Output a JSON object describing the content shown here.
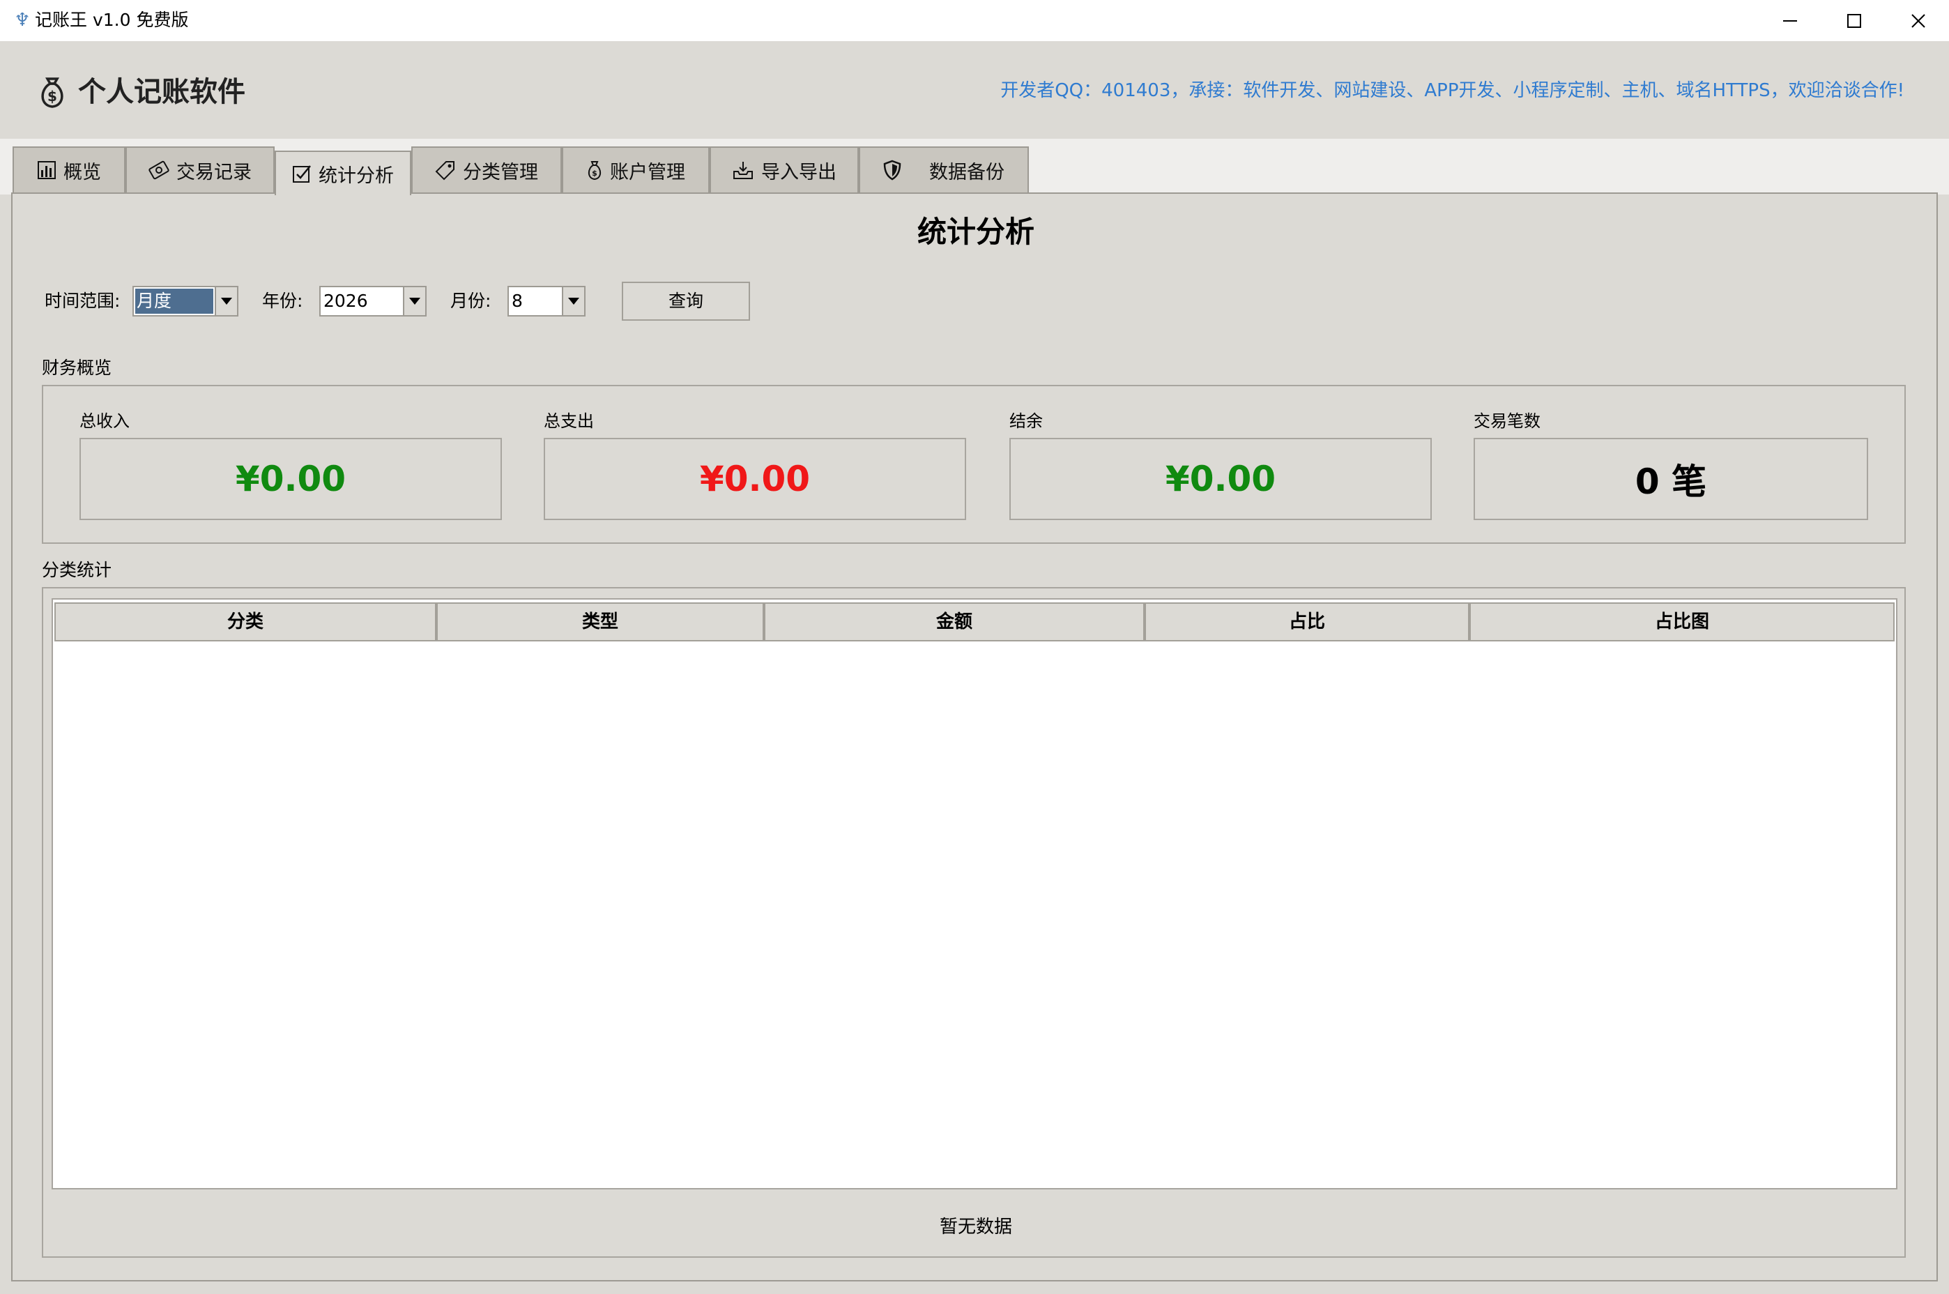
{
  "window": {
    "title": "记账王 v1.0 免费版",
    "controls": {
      "minimize": "minimize-icon",
      "maximize": "maximize-icon",
      "close": "close-icon"
    }
  },
  "header": {
    "app_title": "个人记账软件",
    "developer_note": "开发者QQ：401403，承接：软件开发、网站建设、APP开发、小程序定制、主机、域名HTTPS，欢迎洽谈合作!"
  },
  "tabs": [
    {
      "label": "概览",
      "icon": "bar-chart-icon"
    },
    {
      "label": "交易记录",
      "icon": "money-icon"
    },
    {
      "label": "统计分析",
      "icon": "checkbox-icon",
      "active": true
    },
    {
      "label": "分类管理",
      "icon": "tag-icon"
    },
    {
      "label": "账户管理",
      "icon": "money-bag-icon"
    },
    {
      "label": "导入导出",
      "icon": "inbox-tray-icon"
    },
    {
      "label": "数据备份",
      "icon": "shield-icon"
    }
  ],
  "page": {
    "title": "统计分析",
    "filters": {
      "range_label": "时间范围:",
      "range_value": "月度",
      "year_label": "年份:",
      "year_value": "2026",
      "month_label": "月份:",
      "month_value": "8",
      "query_button": "查询"
    },
    "overview": {
      "group_label": "财务概览",
      "cards": [
        {
          "label": "总收入",
          "value": "¥0.00",
          "color": "#108a10"
        },
        {
          "label": "总支出",
          "value": "¥0.00",
          "color": "#f01818"
        },
        {
          "label": "结余",
          "value": "¥0.00",
          "color": "#108a10"
        },
        {
          "label": "交易笔数",
          "value": "0 笔",
          "color": "#000000"
        }
      ]
    },
    "category": {
      "group_label": "分类统计",
      "columns": [
        "分类",
        "类型",
        "金额",
        "占比",
        "占比图"
      ],
      "rows": [],
      "empty_text": "暂无数据"
    }
  },
  "colors": {
    "window_bg": "#dcdad5",
    "accent_link": "#2f7bd0",
    "income": "#108a10",
    "expense": "#f01818",
    "selection": "#4e6e90"
  }
}
